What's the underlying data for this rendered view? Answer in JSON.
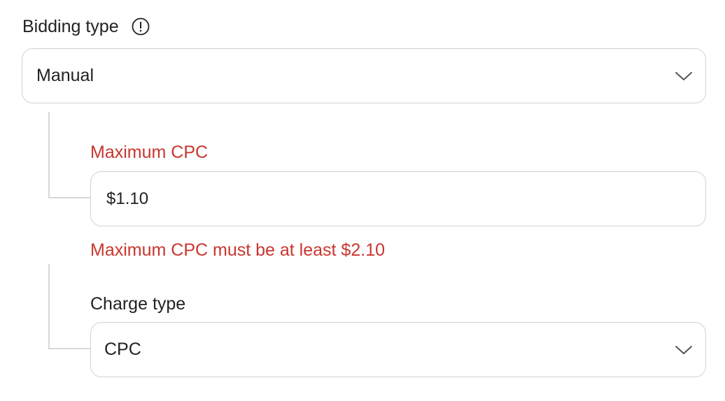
{
  "bidding": {
    "label": "Bidding type",
    "info_icon": "info-circle-icon",
    "selected": "Manual",
    "chevron_icon": "chevron-down-icon"
  },
  "max_cpc": {
    "label": "Maximum CPC",
    "value": "$1.10",
    "error": "Maximum CPC must be at least $2.10"
  },
  "charge_type": {
    "label": "Charge type",
    "selected": "CPC",
    "chevron_icon": "chevron-down-icon"
  },
  "colors": {
    "error": "#c8362f",
    "text": "#222222",
    "border": "#d2d2d2",
    "connector": "#d8d8d8"
  }
}
